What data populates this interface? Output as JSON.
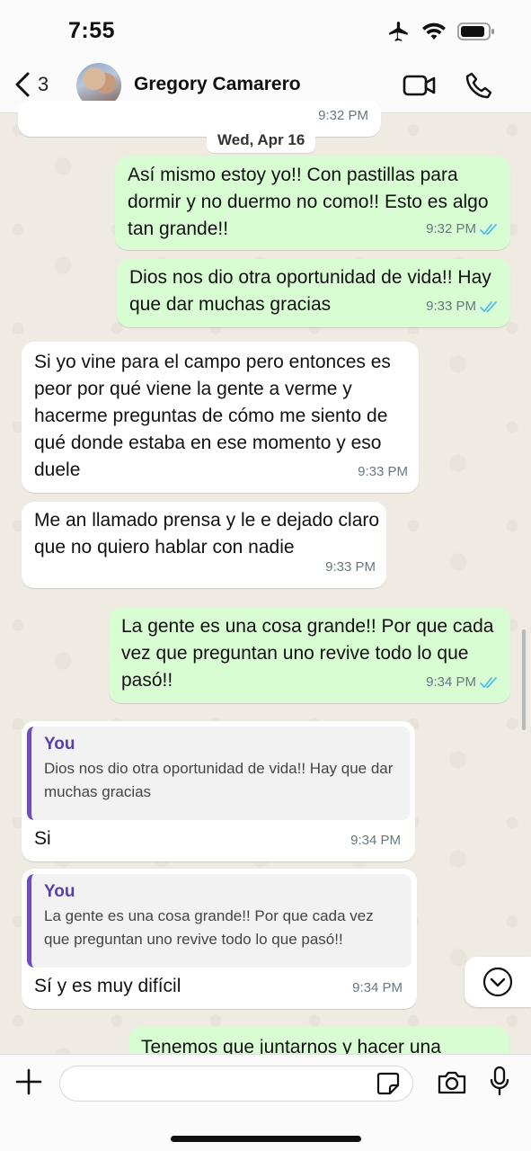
{
  "status_bar": {
    "time": "7:55"
  },
  "header": {
    "back_count": "3",
    "contact_name": "Gregory Camarero"
  },
  "chat": {
    "top_partial_time": "9:32 PM",
    "date_separator": "Wed, Apr 16",
    "messages": [
      {
        "dir": "out",
        "text": "Así mismo estoy yo!! Con pastillas para dormir y no duermo no como!! Esto es algo tan grande!!",
        "time": "9:32 PM",
        "read": true
      },
      {
        "dir": "out",
        "text": "Dios nos dio otra oportunidad de vida!! Hay que dar muchas gracias",
        "time": "9:33 PM",
        "read": true
      },
      {
        "dir": "in",
        "text": "Si yo vine para el campo pero entonces es peor por qué viene la gente a verme y hacerme preguntas de cómo me siento de qué donde estaba en ese momento y eso duele",
        "time": "9:33 PM"
      },
      {
        "dir": "in",
        "text": "Me an llamado prensa y le e dejado claro que no quiero hablar con nadie",
        "time": "9:33 PM"
      },
      {
        "dir": "out",
        "text": "La gente es una cosa grande!! Por que cada vez que preguntan uno revive todo lo que pasó!!",
        "time": "9:34 PM",
        "read": true
      },
      {
        "dir": "in",
        "quote_author": "You",
        "quote_text": "Dios nos dio otra oportunidad de vida!! Hay que dar muchas gracias",
        "text": "Si",
        "time": "9:34 PM"
      },
      {
        "dir": "in",
        "quote_author": "You",
        "quote_text": "La gente es una cosa grande!! Por que cada vez que preguntan uno revive todo lo que pasó!!",
        "text": "Sí y es muy difícil",
        "time": "9:34 PM"
      },
      {
        "dir": "out",
        "text": "Tenemos que juntarnos y hacer una"
      }
    ]
  },
  "composer": {
    "value": "",
    "placeholder": ""
  },
  "icons": {
    "back": "chevron-left-icon",
    "video": "video-call-icon",
    "phone": "phone-icon",
    "read": "double-check-icon",
    "scroll": "chevron-down-circle-icon",
    "plus": "plus-icon",
    "sticker": "sticker-icon",
    "camera": "camera-icon",
    "mic": "microphone-icon"
  },
  "colors": {
    "outgoing_bubble": "#d9fdd3",
    "incoming_bubble": "#ffffff",
    "read_ticks": "#53bdeb",
    "quote_accent": "#6b4fbb"
  }
}
